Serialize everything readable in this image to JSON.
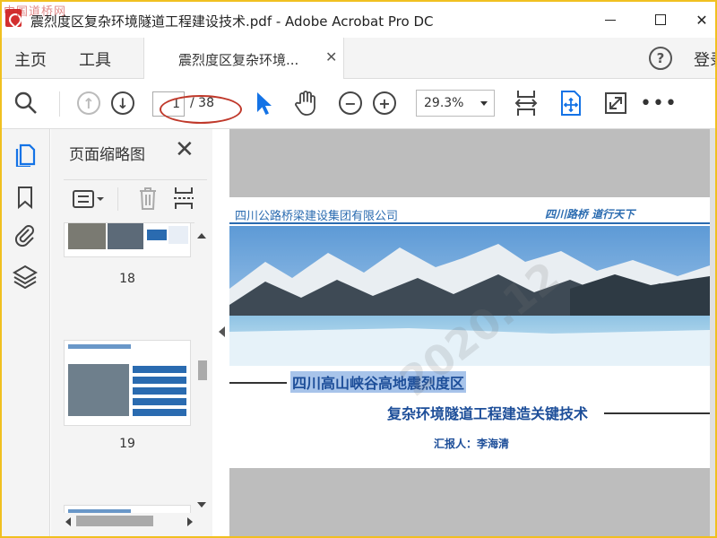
{
  "window": {
    "watermark_site": "中国道桥网",
    "title": "震烈度区复杂环境隧道工程建设技术.pdf - Adobe Acrobat Pro DC",
    "minimize": "",
    "maximize": "",
    "close": "✕"
  },
  "tabbar": {
    "home": "主页",
    "tools": "工具",
    "doc_tab_label": "震烈度区复杂环境...",
    "doc_tab_close": "✕",
    "help": "?",
    "signin": "登录"
  },
  "toolbar": {
    "page_current": "1",
    "page_total": "/ 38",
    "zoom": "29.3%",
    "more": "•••"
  },
  "thumbnails": {
    "title": "页面缩略图",
    "close": "✕",
    "pages": [
      {
        "number": "18"
      },
      {
        "number": "19"
      }
    ]
  },
  "document": {
    "company": "四川公路桥梁建设集团有限公司",
    "brand": "四川路桥 道行天下",
    "title_line1": "四川高山峡谷高地震烈度区",
    "title_line2": "复杂环境隧道工程建造关键技术",
    "presenter": "汇报人：李海清",
    "watermark": "2020.12"
  },
  "colors": {
    "accent_blue": "#2a6bb0",
    "acrobat_select": "#1473e6",
    "annotation_red": "#c0392b",
    "outer_border": "#f0c020"
  },
  "icons": [
    "search-icon",
    "page-up-icon",
    "page-down-icon",
    "select-arrow-icon",
    "hand-tool-icon",
    "zoom-out-icon",
    "zoom-in-icon",
    "fit-width-icon",
    "rotate-icon",
    "fullscreen-icon",
    "more-icon",
    "page-thumbnails-icon",
    "bookmark-icon",
    "attachment-icon",
    "layers-icon",
    "thumbnail-options-icon",
    "delete-icon",
    "insert-page-icon"
  ]
}
